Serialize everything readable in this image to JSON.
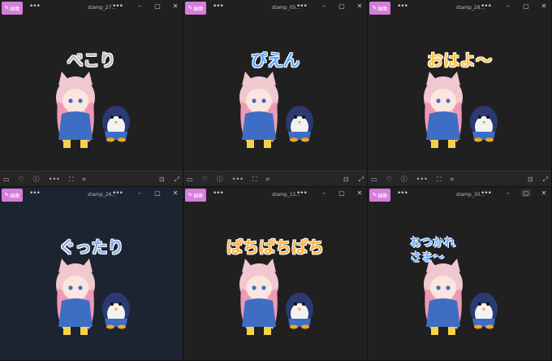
{
  "windows": [
    {
      "title": "stamp_27...",
      "caption": "ぺこり",
      "caption_color": "#b8b8b8",
      "edit_label": "編集"
    },
    {
      "title": "stamp_05...",
      "caption": "ぴえん",
      "caption_color": "#5aa8ff",
      "edit_label": "編集"
    },
    {
      "title": "stamp_28...",
      "caption": "おはよ〜",
      "caption_color": "#ffc43a",
      "edit_label": "編集"
    },
    {
      "title": "stamp_26...",
      "caption": "ぐったり",
      "caption_color": "#8aa7e6",
      "edit_label": "編集"
    },
    {
      "title": "stamp_15...",
      "caption": "ぱちぱちぱち",
      "caption_color": "#ffb23f",
      "edit_label": "編集"
    },
    {
      "title": "stamp_30...",
      "caption_line1": "おつかれ",
      "caption_line2": "さま〜",
      "caption_color": "#66aaff",
      "edit_label": "編集"
    }
  ],
  "icons": {
    "edit": "edit-pencil-icon",
    "more": "more-icon",
    "minimize": "minimize-icon",
    "maximize": "maximize-icon",
    "close": "close-icon",
    "toolbar": [
      "image-size-icon",
      "favorite-heart-icon",
      "info-icon",
      "more-icon",
      "crop-icon",
      "visual-search-icon",
      "fit-window-icon",
      "fullscreen-icon"
    ]
  },
  "colors": {
    "accent": "#d77ddc",
    "background": "#202020",
    "navy_background": "#1c2431"
  }
}
